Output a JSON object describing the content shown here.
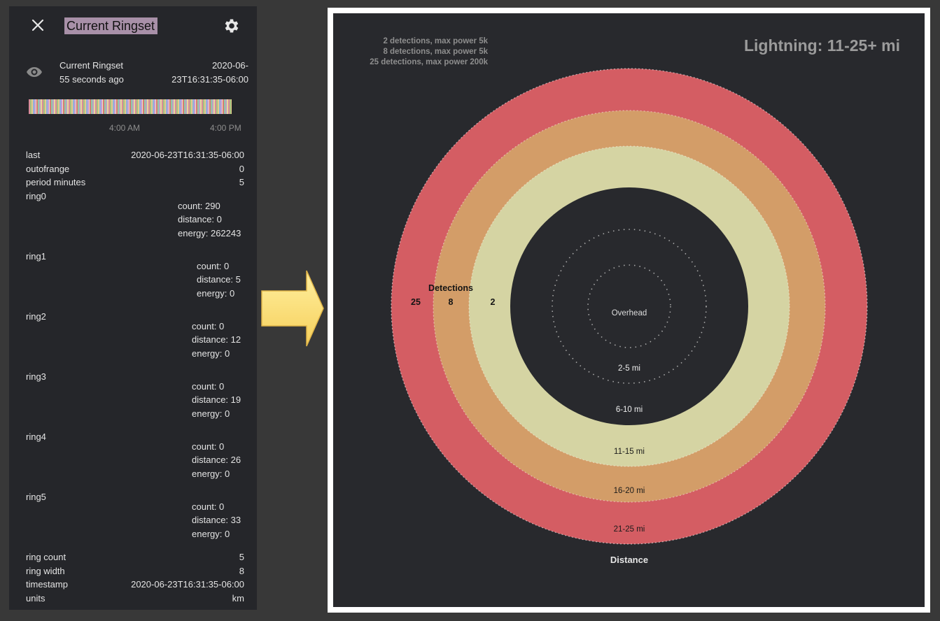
{
  "panel": {
    "title": "Current Ringset",
    "icons": {
      "close": "close-icon",
      "settings": "gear-icon",
      "entity": "eye-icon"
    },
    "entity": {
      "name": "Current Ringset",
      "age": "55 seconds ago",
      "timestamp_line1": "2020-06-",
      "timestamp_line2": "23T16:31:35-06:00"
    },
    "history": {
      "start_label": "4:00 AM",
      "end_label": "4:00 PM"
    },
    "attributes": {
      "last_key": "last",
      "last_val": "2020-06-23T16:31:35-06:00",
      "outofrange_key": "outofrange",
      "outofrange_val": "0",
      "period_key": "period minutes",
      "period_val": "5",
      "ring_count_key": "ring count",
      "ring_count_val": "5",
      "ring_width_key": "ring width",
      "ring_width_val": "8",
      "timestamp_key": "timestamp",
      "timestamp_val": "2020-06-23T16:31:35-06:00",
      "units_key": "units",
      "units_val": "km"
    },
    "rings": [
      {
        "name": "ring0",
        "count": "count: 290",
        "distance": "distance: 0",
        "energy": "energy: 262243"
      },
      {
        "name": "ring1",
        "count": "count: 0",
        "distance": "distance: 5",
        "energy": "energy: 0"
      },
      {
        "name": "ring2",
        "count": "count: 0",
        "distance": "distance: 12",
        "energy": "energy: 0"
      },
      {
        "name": "ring3",
        "count": "count: 0",
        "distance": "distance: 19",
        "energy": "energy: 0"
      },
      {
        "name": "ring4",
        "count": "count: 0",
        "distance": "distance: 26",
        "energy": "energy: 0"
      },
      {
        "name": "ring5",
        "count": "count: 0",
        "distance": "distance: 33",
        "energy": "energy: 0"
      }
    ]
  },
  "arrow": {
    "color": "#ffe27a"
  },
  "chart": {
    "title": "Lightning: 11-25+ mi",
    "legend": [
      "2 detections, max power 5k",
      "8 detections, max power 5k",
      "25 detections, max power 200k"
    ],
    "detections_label": "Detections",
    "detection_counts": [
      "25",
      "8",
      "2"
    ],
    "distance_label": "Distance",
    "ring_labels": [
      "Overhead",
      "2-5 mi",
      "6-10 mi",
      "11-15 mi",
      "16-20 mi",
      "21-25 mi"
    ],
    "colors": {
      "outer": "#d45d63",
      "middle": "#d39d68",
      "inner": "#d5d4a3",
      "background": "#28292d"
    }
  },
  "chart_data": {
    "type": "radial-rings",
    "title": "Lightning: 11-25+ mi",
    "categories": [
      "Overhead",
      "2-5 mi",
      "6-10 mi",
      "11-15 mi",
      "16-20 mi",
      "21-25 mi"
    ],
    "series": [
      {
        "name": "Detections",
        "values": [
          0,
          0,
          0,
          2,
          8,
          25
        ]
      }
    ],
    "xlabel": "Distance",
    "legend": [
      "2 detections, max power 5k",
      "8 detections, max power 5k",
      "25 detections, max power 200k"
    ]
  }
}
